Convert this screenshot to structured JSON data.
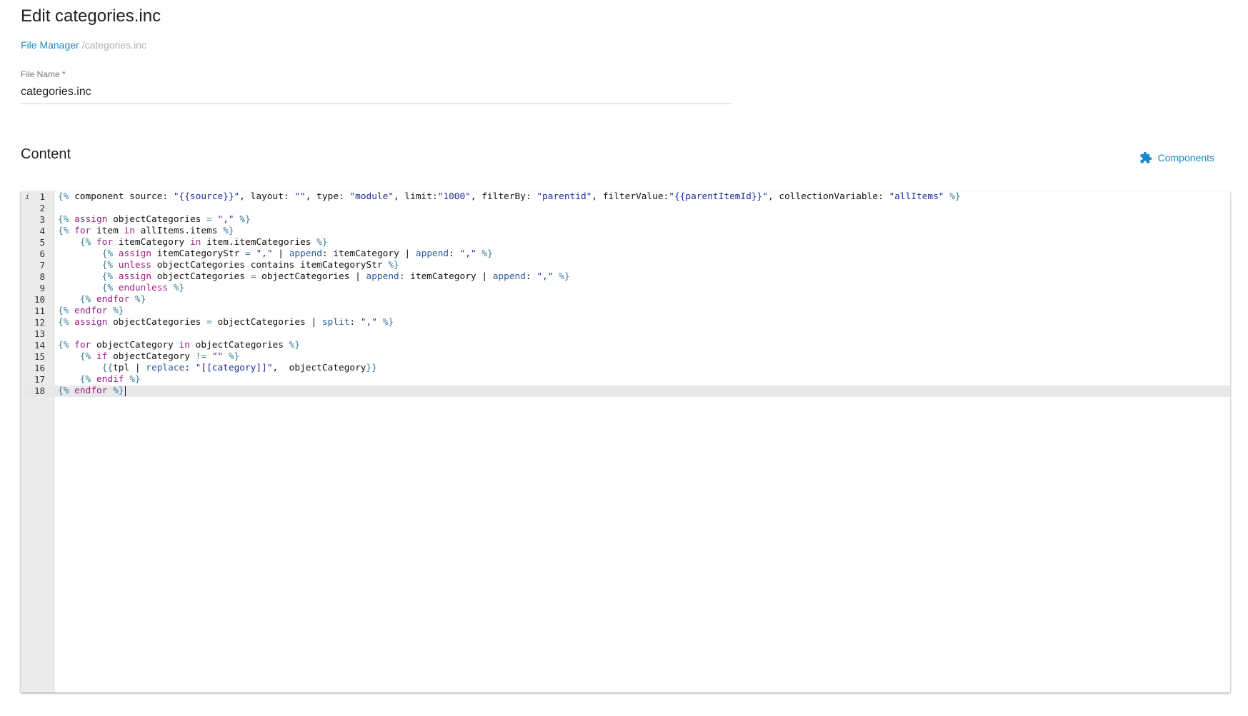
{
  "page": {
    "title": "Edit categories.inc"
  },
  "breadcrumb": {
    "link_label": "File Manager",
    "current": "/categories.inc"
  },
  "form": {
    "file_name_label": "File Name *",
    "file_name_value": "categories.inc"
  },
  "content": {
    "section_title": "Content",
    "components_label": "Components",
    "components_icon": "puzzle-icon"
  },
  "editor": {
    "active_line": 18,
    "info_marker": "i",
    "lines": [
      {
        "n": "1",
        "tokens": [
          [
            "d",
            "{%"
          ],
          [
            "p",
            " component source: "
          ],
          [
            "s",
            "\"{{source}}\""
          ],
          [
            "p",
            ", layout: "
          ],
          [
            "s",
            "\"\""
          ],
          [
            "p",
            ", type: "
          ],
          [
            "s",
            "\"module\""
          ],
          [
            "p",
            ", limit:"
          ],
          [
            "s",
            "\"1000\""
          ],
          [
            "p",
            ", filterBy: "
          ],
          [
            "s",
            "\"parentid\""
          ],
          [
            "p",
            ", filterValue:"
          ],
          [
            "s",
            "\"{{parentItemId}}\""
          ],
          [
            "p",
            ", collectionVariable: "
          ],
          [
            "s",
            "\"allItems\""
          ],
          [
            "p",
            " "
          ],
          [
            "d",
            "%}"
          ]
        ]
      },
      {
        "n": "2",
        "tokens": []
      },
      {
        "n": "3",
        "tokens": [
          [
            "d",
            "{%"
          ],
          [
            "p",
            " "
          ],
          [
            "k",
            "assign"
          ],
          [
            "p",
            " objectCategories "
          ],
          [
            "d",
            "="
          ],
          [
            "p",
            " "
          ],
          [
            "s",
            "\",\""
          ],
          [
            "p",
            " "
          ],
          [
            "d",
            "%}"
          ]
        ]
      },
      {
        "n": "4",
        "tokens": [
          [
            "d",
            "{%"
          ],
          [
            "p",
            " "
          ],
          [
            "k",
            "for"
          ],
          [
            "p",
            " item "
          ],
          [
            "k",
            "in"
          ],
          [
            "p",
            " allItems.items "
          ],
          [
            "d",
            "%}"
          ]
        ]
      },
      {
        "n": "5",
        "tokens": [
          [
            "p",
            "    "
          ],
          [
            "d",
            "{%"
          ],
          [
            "p",
            " "
          ],
          [
            "k",
            "for"
          ],
          [
            "p",
            " itemCategory "
          ],
          [
            "k",
            "in"
          ],
          [
            "p",
            " item.itemCategories "
          ],
          [
            "d",
            "%}"
          ]
        ]
      },
      {
        "n": "6",
        "tokens": [
          [
            "p",
            "        "
          ],
          [
            "d",
            "{%"
          ],
          [
            "p",
            " "
          ],
          [
            "k",
            "assign"
          ],
          [
            "p",
            " itemCategoryStr "
          ],
          [
            "d",
            "="
          ],
          [
            "p",
            " "
          ],
          [
            "s",
            "\",\""
          ],
          [
            "p",
            " | "
          ],
          [
            "f",
            "append"
          ],
          [
            "p",
            ": itemCategory | "
          ],
          [
            "f",
            "append"
          ],
          [
            "p",
            ": "
          ],
          [
            "s",
            "\",\""
          ],
          [
            "p",
            " "
          ],
          [
            "d",
            "%}"
          ]
        ]
      },
      {
        "n": "7",
        "tokens": [
          [
            "p",
            "        "
          ],
          [
            "d",
            "{%"
          ],
          [
            "p",
            " "
          ],
          [
            "k",
            "unless"
          ],
          [
            "p",
            " objectCategories contains itemCategoryStr "
          ],
          [
            "d",
            "%}"
          ]
        ]
      },
      {
        "n": "8",
        "tokens": [
          [
            "p",
            "        "
          ],
          [
            "d",
            "{%"
          ],
          [
            "p",
            " "
          ],
          [
            "k",
            "assign"
          ],
          [
            "p",
            " objectCategories "
          ],
          [
            "d",
            "="
          ],
          [
            "p",
            " objectCategories | "
          ],
          [
            "f",
            "append"
          ],
          [
            "p",
            ": itemCategory | "
          ],
          [
            "f",
            "append"
          ],
          [
            "p",
            ": "
          ],
          [
            "s",
            "\",\""
          ],
          [
            "p",
            " "
          ],
          [
            "d",
            "%}"
          ]
        ]
      },
      {
        "n": "9",
        "tokens": [
          [
            "p",
            "        "
          ],
          [
            "d",
            "{%"
          ],
          [
            "p",
            " "
          ],
          [
            "k",
            "endunless"
          ],
          [
            "p",
            " "
          ],
          [
            "d",
            "%}"
          ]
        ]
      },
      {
        "n": "10",
        "tokens": [
          [
            "p",
            "    "
          ],
          [
            "d",
            "{%"
          ],
          [
            "p",
            " "
          ],
          [
            "k",
            "endfor"
          ],
          [
            "p",
            " "
          ],
          [
            "d",
            "%}"
          ]
        ]
      },
      {
        "n": "11",
        "tokens": [
          [
            "d",
            "{%"
          ],
          [
            "p",
            " "
          ],
          [
            "k",
            "endfor"
          ],
          [
            "p",
            " "
          ],
          [
            "d",
            "%}"
          ]
        ]
      },
      {
        "n": "12",
        "tokens": [
          [
            "d",
            "{%"
          ],
          [
            "p",
            " "
          ],
          [
            "k",
            "assign"
          ],
          [
            "p",
            " objectCategories "
          ],
          [
            "d",
            "="
          ],
          [
            "p",
            " objectCategories | "
          ],
          [
            "f",
            "split"
          ],
          [
            "p",
            ": "
          ],
          [
            "s",
            "\",\""
          ],
          [
            "p",
            " "
          ],
          [
            "d",
            "%}"
          ]
        ]
      },
      {
        "n": "13",
        "tokens": []
      },
      {
        "n": "14",
        "tokens": [
          [
            "d",
            "{%"
          ],
          [
            "p",
            " "
          ],
          [
            "k",
            "for"
          ],
          [
            "p",
            " objectCategory "
          ],
          [
            "k",
            "in"
          ],
          [
            "p",
            " objectCategories "
          ],
          [
            "d",
            "%}"
          ]
        ]
      },
      {
        "n": "15",
        "tokens": [
          [
            "p",
            "    "
          ],
          [
            "d",
            "{%"
          ],
          [
            "p",
            " "
          ],
          [
            "k",
            "if"
          ],
          [
            "p",
            " objectCategory "
          ],
          [
            "d",
            "!="
          ],
          [
            "p",
            " "
          ],
          [
            "s",
            "\"\""
          ],
          [
            "p",
            " "
          ],
          [
            "d",
            "%}"
          ]
        ]
      },
      {
        "n": "16",
        "tokens": [
          [
            "p",
            "        "
          ],
          [
            "d",
            "{{"
          ],
          [
            "p",
            "tpl | "
          ],
          [
            "f",
            "replace"
          ],
          [
            "p",
            ": "
          ],
          [
            "s",
            "\"[[category]]\""
          ],
          [
            "p",
            ",  objectCategory"
          ],
          [
            "d",
            "}}"
          ]
        ]
      },
      {
        "n": "17",
        "tokens": [
          [
            "p",
            "    "
          ],
          [
            "d",
            "{%"
          ],
          [
            "p",
            " "
          ],
          [
            "k",
            "endif"
          ],
          [
            "p",
            " "
          ],
          [
            "d",
            "%}"
          ]
        ]
      },
      {
        "n": "18",
        "tokens": [
          [
            "d",
            "{%"
          ],
          [
            "p",
            " "
          ],
          [
            "k",
            "endfor"
          ],
          [
            "p",
            " "
          ],
          [
            "d",
            "%}"
          ]
        ]
      }
    ]
  }
}
